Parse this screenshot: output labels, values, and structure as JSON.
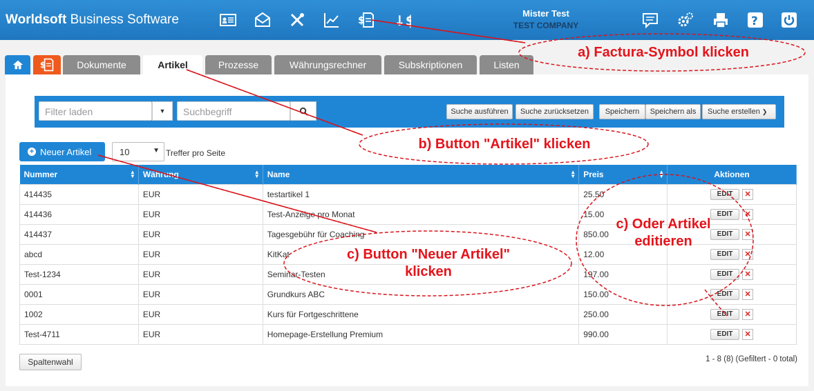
{
  "header": {
    "brand_bold": "Worldsoft",
    "brand_rest": " Business Software",
    "user_name": "Mister Test",
    "company": "TEST COMPANY",
    "icons": [
      "contact-card-icon",
      "mail-icon",
      "tools-icon",
      "chart-icon",
      "factura-icon",
      "currency-icon",
      "message-icon",
      "settings-icon",
      "print-icon",
      "help-icon",
      "power-icon"
    ]
  },
  "tabs": [
    "Dokumente",
    "Artikel",
    "Prozesse",
    "Währungsrechner",
    "Subskriptionen",
    "Listen"
  ],
  "search": {
    "filter_placeholder": "Filter laden",
    "term_placeholder": "Suchbegriff",
    "buttons": [
      "Suche ausführen",
      "Suche zurücksetzen",
      "Speichern",
      "Speichern als",
      "Suche erstellen"
    ]
  },
  "toolbar": {
    "new_label": "Neuer Artikel",
    "per_page_value": "10",
    "per_page_label": "Treffer pro Seite"
  },
  "table": {
    "columns": [
      "Nummer",
      "Währung",
      "Name",
      "Preis",
      "Aktionen"
    ],
    "edit_label": "EDIT",
    "delete_label": "✕",
    "rows": [
      [
        "414435",
        "EUR",
        "testartikel 1",
        "25.50"
      ],
      [
        "414436",
        "EUR",
        "Test-Anzeige pro Monat",
        "15.00"
      ],
      [
        "414437",
        "EUR",
        "Tagesgebühr für Coaching",
        "850.00"
      ],
      [
        "abcd",
        "EUR",
        "KitKat",
        "12.00"
      ],
      [
        "Test-1234",
        "EUR",
        "Seminar-Testen",
        "197.00"
      ],
      [
        "0001",
        "EUR",
        "Grundkurs ABC",
        "150.00"
      ],
      [
        "1002",
        "EUR",
        "Kurs für Fortgeschrittene",
        "250.00"
      ],
      [
        "Test-4711",
        "EUR",
        "Homepage-Erstellung Premium",
        "990.00"
      ]
    ]
  },
  "footer": {
    "columns_button": "Spaltenwahl",
    "page_info": "1 - 8 (8) (Gefiltert - 0 total)"
  },
  "annotations": {
    "a": "a) Factura-Symbol klicken",
    "b": "b) Button \"Artikel\" klicken",
    "c1_line1": "c) Button \"Neuer Artikel\"",
    "c1_line2": "klicken",
    "c2_line1": "c) Oder Artikel",
    "c2_line2": "editieren"
  },
  "colors": {
    "primary": "#1f86d6",
    "factura_tab": "#ef5a1d",
    "annotation": "#e4141b"
  }
}
